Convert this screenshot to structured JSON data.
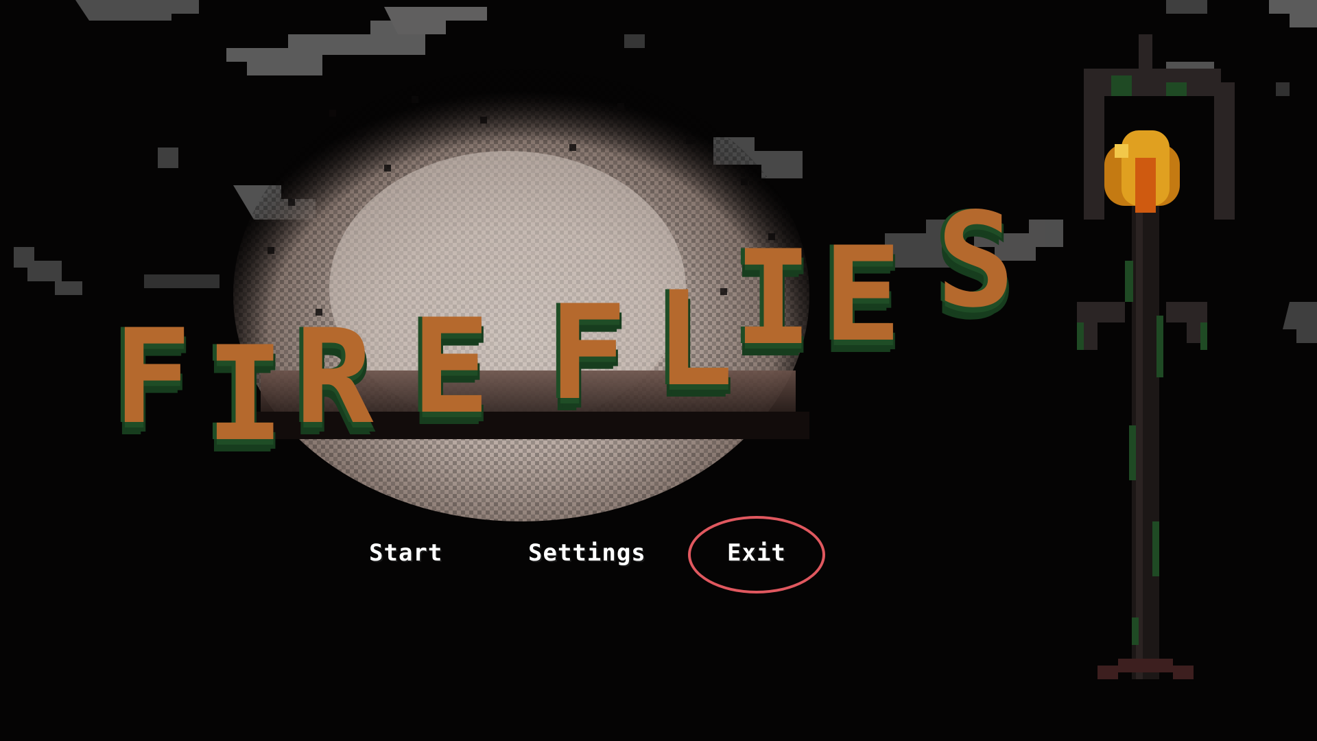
{
  "game": {
    "title_letters": [
      "F",
      "I",
      "R",
      "E",
      "F",
      "L",
      "I",
      "E",
      "S"
    ]
  },
  "menu": {
    "start_label": "Start",
    "settings_label": "Settings",
    "exit_label": "Exit",
    "highlighted_item": "Exit"
  },
  "colors": {
    "background": "#050404",
    "title_fill": "#b5692d",
    "title_moss": "#1f4d26",
    "highlight_ring": "#e0585f",
    "menu_text": "#ffffff",
    "lamp_flame": "#e0a020"
  }
}
